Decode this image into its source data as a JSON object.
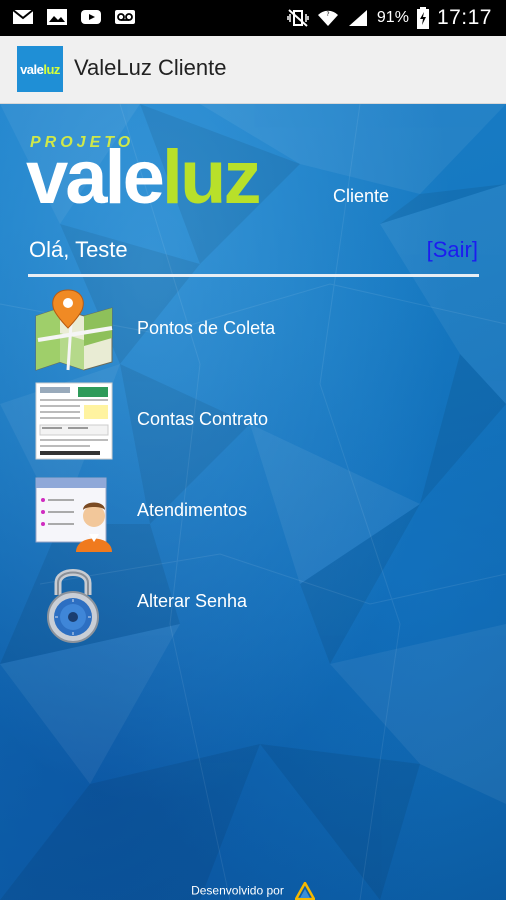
{
  "status_bar": {
    "battery_percent": "91%",
    "time": "17:17",
    "left_icons": [
      "gmail-icon",
      "gallery-icon",
      "youtube-icon",
      "voicemail-icon"
    ],
    "right_icons": [
      "vibrate-icon",
      "wifi-icon",
      "signal-icon",
      "battery-icon"
    ]
  },
  "action_bar": {
    "title": "ValeLuz Cliente",
    "app_icon_text_vale": "vale",
    "app_icon_text_luz": "luz"
  },
  "logo": {
    "projeto": "PROJETO",
    "vale": "vale",
    "luz": "luz",
    "cliente": "Cliente"
  },
  "greeting": "Olá, Teste",
  "logout_label": "[Sair]",
  "menu": [
    {
      "label": "Pontos de Coleta",
      "icon": "map-pin-icon"
    },
    {
      "label": "Contas Contrato",
      "icon": "document-icon"
    },
    {
      "label": "Atendimentos",
      "icon": "user-card-icon"
    },
    {
      "label": "Alterar Senha",
      "icon": "padlock-icon"
    }
  ],
  "footer": {
    "text": "Desenvolvido por",
    "logo_icon": "developer-logo-icon"
  },
  "colors": {
    "accent_green": "#b8e02a",
    "background_blue": "#1577bf",
    "link_blue": "#1c1cf0"
  }
}
